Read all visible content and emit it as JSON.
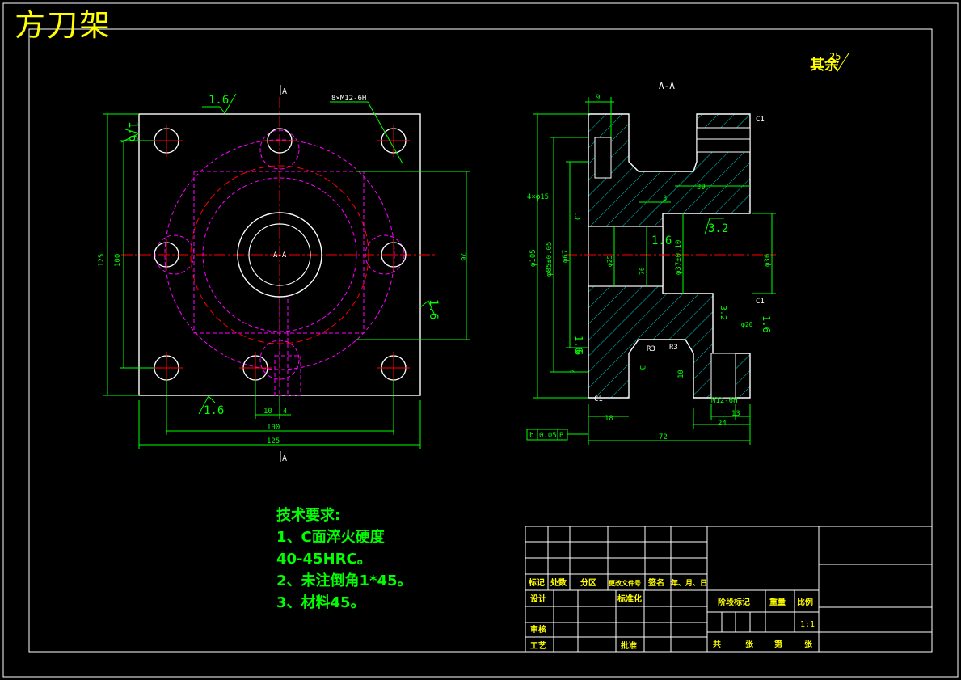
{
  "drawing": {
    "title": "方刀架",
    "surface_note": "其余",
    "surface_note_value": "25",
    "section_label": "A-A",
    "section_mark": "A"
  },
  "front_view": {
    "roughness_top": "1.6",
    "roughness_left": "1.6",
    "roughness_right": "1.6",
    "roughness_bottom": "1.6",
    "thread_callout": "8×M12-6H",
    "center_label": "A-A",
    "dim_height_outer": "125",
    "dim_height_inner": "100",
    "dim_right": "76",
    "dim_width_outer": "125",
    "dim_width_inner": "100",
    "dim_10": "10",
    "dim_4": "4"
  },
  "section_view": {
    "dim_9": "9",
    "chamfer_top": "C1",
    "chamfer_mid": "C1",
    "chamfer_bottom": "C1",
    "dim_39": "39",
    "dim_3": "3",
    "dim_4x15": "4×φ15",
    "dim_c1_left": "C1",
    "dim_phi105": "φ105",
    "dim_phi85": "φ85±0.05",
    "dim_phi67": "φ67",
    "dim_phi25": "φ25",
    "dim_76": "76",
    "dim_phi37": "φ37±0.10",
    "dim_phi36": "φ36",
    "dim_phi20": "φ20",
    "roughness_16": "1.6",
    "roughness_32a": "3.2",
    "roughness_32b": "3.2",
    "roughness_16b": "1.6",
    "roughness_6": "6",
    "roughness_16c": "1.6",
    "r3a": "R3",
    "r3b": "R3",
    "dim_3b": "3",
    "dim_2": "2",
    "dim_10": "10",
    "dim_18": "18",
    "dim_13": "13",
    "dim_24": "24",
    "dim_72": "72",
    "thread_m12": "M12-6H",
    "tolerance_b": "b",
    "tolerance_val": "0.05",
    "tolerance_ref": "B"
  },
  "tech_requirements": {
    "heading": "技术要求:",
    "line1": "1、C面淬火硬度",
    "line2": "40-45HRC。",
    "line3": "2、未注倒角1*45。",
    "line4": "3、材料45。"
  },
  "title_block": {
    "r1": "标记",
    "r2": "处数",
    "r3": "分区",
    "r4": "更改文件号",
    "r5": "签名",
    "r6": "年、月、日",
    "design": "设计",
    "standard": "标准化",
    "stage": "阶段标记",
    "weight": "重量",
    "scale": "比例",
    "scale_val": "1:1",
    "review": "审核",
    "process": "工艺",
    "approve": "批准",
    "total": "共",
    "sheets": "张",
    "page": "第",
    "page_end": "张"
  },
  "colors": {
    "frame": "#ffffff",
    "outline": "#ffffff",
    "dimension": "#00ff00",
    "center": "#ff0000",
    "hidden": "#ff00ff",
    "hatch": "#00ffff",
    "title": "#ffff00"
  }
}
